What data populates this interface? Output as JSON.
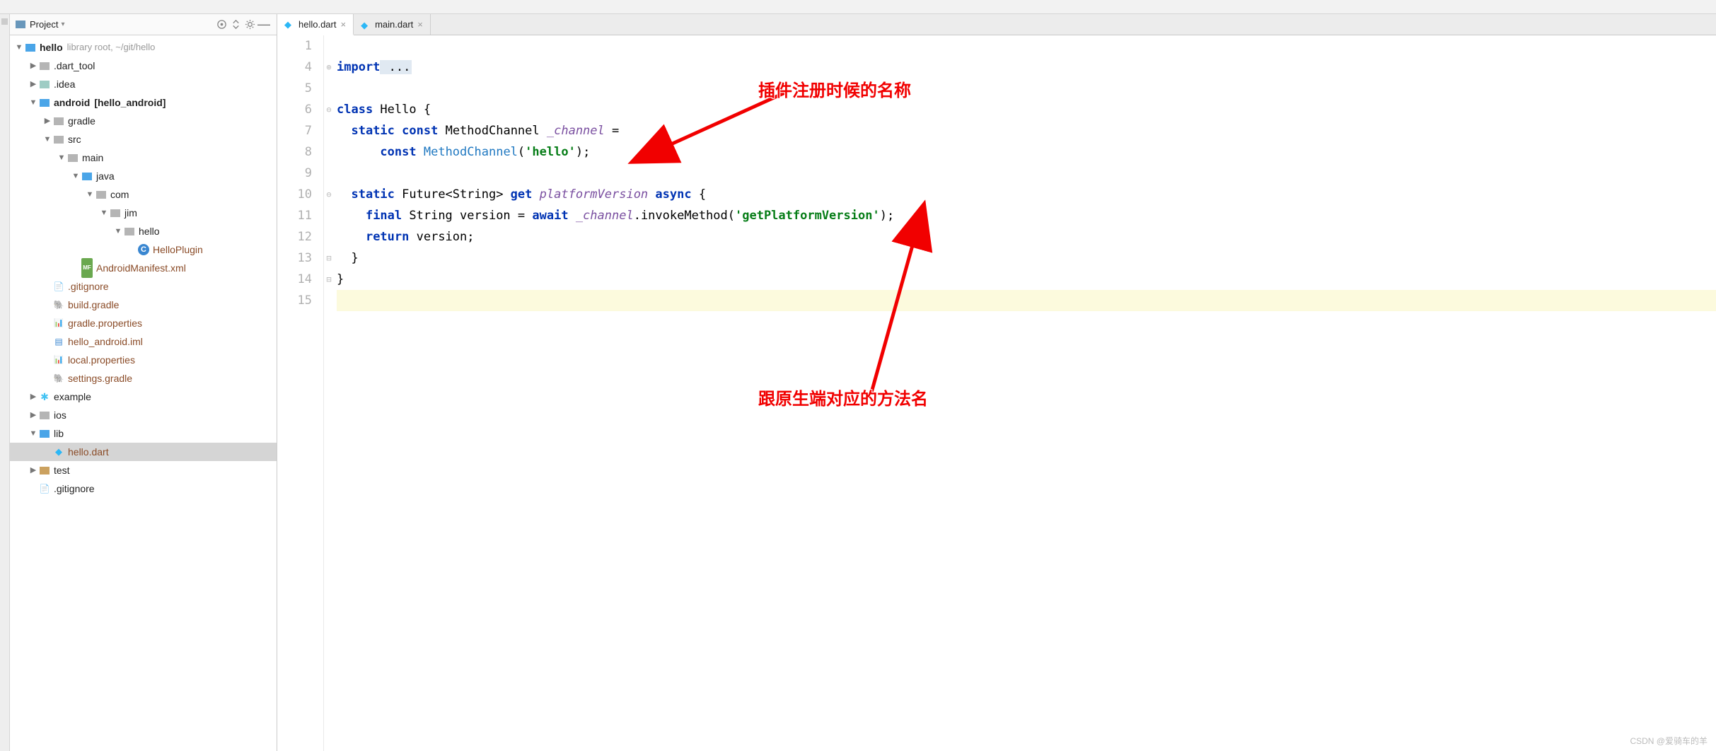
{
  "project_panel": {
    "title": "Project",
    "tools": [
      "target",
      "expand",
      "gear",
      "minimize"
    ]
  },
  "tree": [
    {
      "depth": 0,
      "arrow": "▼",
      "icon": "folder-blue",
      "label": "hello",
      "bold": true,
      "suffix": "library root,  ~/git/hello"
    },
    {
      "depth": 1,
      "arrow": "▶",
      "icon": "folder-gray",
      "label": ".dart_tool"
    },
    {
      "depth": 1,
      "arrow": "▶",
      "icon": "folder-teal",
      "label": ".idea",
      "idea": true
    },
    {
      "depth": 1,
      "arrow": "▼",
      "icon": "folder-blue",
      "label": "android",
      "bold": true,
      "bracket": "[hello_android]"
    },
    {
      "depth": 2,
      "arrow": "▶",
      "icon": "folder-gray",
      "label": "gradle"
    },
    {
      "depth": 2,
      "arrow": "▼",
      "icon": "folder-gray",
      "label": "src"
    },
    {
      "depth": 3,
      "arrow": "▼",
      "icon": "folder-gray",
      "label": "main"
    },
    {
      "depth": 4,
      "arrow": "▼",
      "icon": "folder-blue",
      "label": "java"
    },
    {
      "depth": 5,
      "arrow": "▼",
      "icon": "folder-gray",
      "label": "com"
    },
    {
      "depth": 6,
      "arrow": "▼",
      "icon": "folder-gray",
      "label": "jim"
    },
    {
      "depth": 7,
      "arrow": "▼",
      "icon": "folder-gray",
      "label": "hello"
    },
    {
      "depth": 8,
      "arrow": "",
      "icon": "circle-c",
      "label": "HelloPlugin",
      "rust": true
    },
    {
      "depth": 4,
      "arrow": "",
      "icon": "mf",
      "label": "AndroidManifest.xml",
      "rust": true
    },
    {
      "depth": 2,
      "arrow": "",
      "icon": "git",
      "label": ".gitignore",
      "rust": true
    },
    {
      "depth": 2,
      "arrow": "",
      "icon": "elephant",
      "label": "build.gradle",
      "rust": true
    },
    {
      "depth": 2,
      "arrow": "",
      "icon": "props",
      "label": "gradle.properties",
      "rust": true
    },
    {
      "depth": 2,
      "arrow": "",
      "icon": "iml",
      "label": "hello_android.iml",
      "rust": true
    },
    {
      "depth": 2,
      "arrow": "",
      "icon": "props",
      "label": "local.properties",
      "rust": true
    },
    {
      "depth": 2,
      "arrow": "",
      "icon": "elephant",
      "label": "settings.gradle",
      "rust": true
    },
    {
      "depth": 1,
      "arrow": "▶",
      "icon": "flutter",
      "label": "example"
    },
    {
      "depth": 1,
      "arrow": "▶",
      "icon": "folder-gray",
      "label": "ios"
    },
    {
      "depth": 1,
      "arrow": "▼",
      "icon": "folder-blue",
      "label": "lib"
    },
    {
      "depth": 2,
      "arrow": "",
      "icon": "dart",
      "label": "hello.dart",
      "rust": true,
      "selected": true
    },
    {
      "depth": 1,
      "arrow": "▶",
      "icon": "folder-orange",
      "label": "test"
    },
    {
      "depth": 1,
      "arrow": "",
      "icon": "git",
      "label": ".gitignore",
      "cut": true
    }
  ],
  "tabs": [
    {
      "id": "tab-hello",
      "label": "hello.dart",
      "icon": "dart",
      "active": true
    },
    {
      "id": "tab-main",
      "label": "main.dart",
      "icon": "dart",
      "active": false
    }
  ],
  "gutter_lines": [
    "1",
    "4",
    "5",
    "6",
    "7",
    "8",
    "9",
    "10",
    "11",
    "12",
    "13",
    "14",
    "15"
  ],
  "code": {
    "l1": {
      "kw": "import",
      "rest": " ..."
    },
    "l3": {
      "kw1": "class",
      "name": " Hello ",
      "brace": "{"
    },
    "l4": {
      "indent": "  ",
      "kw1": "static",
      "sp1": " ",
      "kw2": "const",
      "sp2": " MethodChannel ",
      "ital": "_channel",
      "eq": " ="
    },
    "l5": {
      "indent": "      ",
      "kw": "const",
      "sp": " ",
      "fn": "MethodChannel",
      "paren1": "(",
      "str": "'hello'",
      "paren2": ");"
    },
    "l7": {
      "indent": "  ",
      "kw1": "static",
      "mid": " Future<String> ",
      "kw2": "get",
      "sp": " ",
      "ital": "platformVersion",
      "sp2": " ",
      "kw3": "async",
      "brace": " {"
    },
    "l8": {
      "indent": "    ",
      "kw": "final",
      "mid": " String version = ",
      "kw2": "await",
      "sp": " ",
      "ital": "_channel",
      "call": ".invokeMethod(",
      "str": "'getPlatformVersion'",
      "end": ");"
    },
    "l9": {
      "indent": "    ",
      "kw": "return",
      "rest": " version;"
    },
    "l10": {
      "indent": "  ",
      "brace": "}"
    },
    "l11": {
      "brace": "}"
    }
  },
  "annotations": {
    "top": "插件注册时候的名称",
    "bottom": "跟原生端对应的方法名"
  },
  "watermark": "CSDN @爱骑车的羊"
}
